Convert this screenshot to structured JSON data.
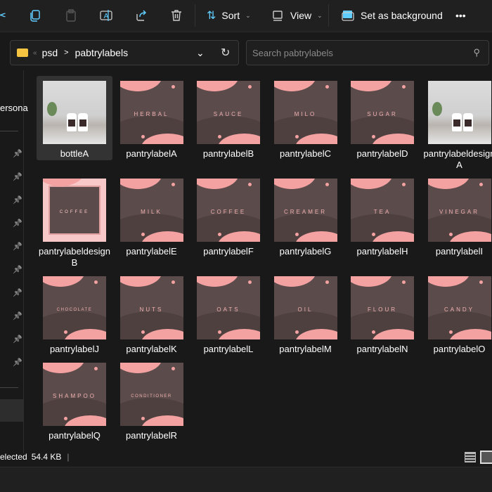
{
  "toolbar": {
    "sort": "Sort",
    "view": "View",
    "set_background": "Set as background",
    "more": "•••"
  },
  "address": {
    "overflow": "«",
    "crumbs": [
      "psd",
      "pabtrylabels"
    ],
    "separator": ">"
  },
  "search": {
    "placeholder": "Search pabtrylabels"
  },
  "sidebar": {
    "partial_label": "ersona",
    "pinned_count": 10
  },
  "files": [
    {
      "name": "bottleA",
      "type": "photo",
      "selected": true
    },
    {
      "name": "pantrylabelA",
      "word": "HERBAL"
    },
    {
      "name": "pantrylabelB",
      "word": "SAUCE"
    },
    {
      "name": "pantrylabelC",
      "word": "MILO"
    },
    {
      "name": "pantrylabelD",
      "word": "SUGAR"
    },
    {
      "name": "pantrylabeldesignA",
      "type": "photo"
    },
    {
      "name": "pantrylabeldesignB",
      "type": "frame",
      "word": "COFFEE"
    },
    {
      "name": "pantrylabelE",
      "word": "MILK"
    },
    {
      "name": "pantrylabelF",
      "word": "COFFEE"
    },
    {
      "name": "pantrylabelG",
      "word": "CREAMER"
    },
    {
      "name": "pantrylabelH",
      "word": "TEA"
    },
    {
      "name": "pantrylabelI",
      "word": "VINEGAR"
    },
    {
      "name": "pantrylabelJ",
      "word": "CHOCOLATE"
    },
    {
      "name": "pantrylabelK",
      "word": "NUTS"
    },
    {
      "name": "pantrylabelL",
      "word": "OATS"
    },
    {
      "name": "pantrylabelM",
      "word": "OIL"
    },
    {
      "name": "pantrylabelN",
      "word": "FLOUR"
    },
    {
      "name": "pantrylabelO",
      "word": "CANDY"
    },
    {
      "name": "pantrylabelQ",
      "word": "SHAMPOO"
    },
    {
      "name": "pantrylabelR",
      "word": "CONDITIONER"
    }
  ],
  "status": {
    "selected": "elected",
    "size": "54.4 KB"
  },
  "colors": {
    "accent": "#60cdff",
    "label_pink": "#f4a1a1",
    "label_brown": "#5b4b4b"
  }
}
